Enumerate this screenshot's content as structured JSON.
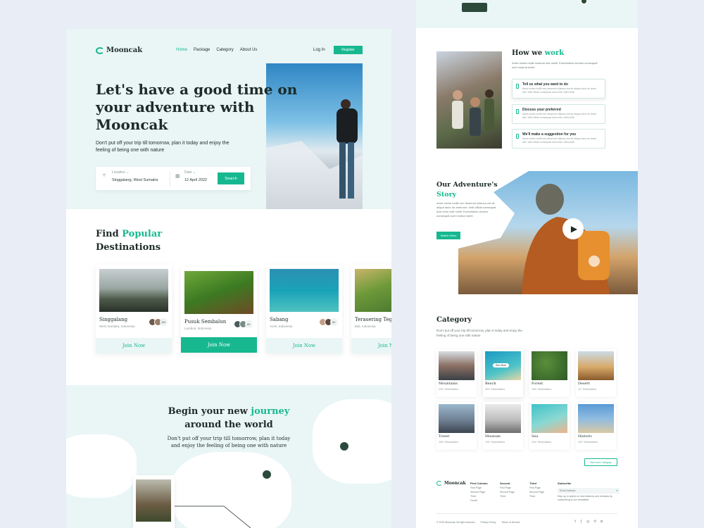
{
  "brand": {
    "name": "Mooncak",
    "accent": "#17b890"
  },
  "nav": {
    "items": [
      "Home",
      "Package",
      "Category",
      "About Us"
    ],
    "login": "Log In",
    "register": "Register"
  },
  "hero": {
    "title_line1": "Let's have a good time on",
    "title_line2": "your adventure with",
    "title_line3": "Mooncak",
    "subtitle": "Don't put off your trip till tomorrow, plan it today and enjoy the feeling of being one with nature"
  },
  "search": {
    "location_label": "Location",
    "location_value": "Singgalang, West Sumatra",
    "date_label": "Date",
    "date_value": "12 April 2022",
    "button": "Search"
  },
  "popular": {
    "title_a": "Find ",
    "title_b": "Popular",
    "title_c": "Destinations",
    "cards": [
      {
        "name": "Singgalang",
        "loc": "West Sumatra, Indonesia",
        "count": "12+",
        "join": "Join Now"
      },
      {
        "name": "Pusuk Sembalun",
        "loc": "Lombok, Indonesia",
        "count": "8+",
        "join": "Join Now"
      },
      {
        "name": "Sabang",
        "loc": "Aceh, Indonesia",
        "count": "6+",
        "join": "Join Now"
      },
      {
        "name": "Terasering Tegallalang",
        "loc": "Bali, Indonesia",
        "count": "",
        "join": "Join Now"
      }
    ]
  },
  "journey": {
    "title_a": "Begin your new ",
    "title_b": "journey",
    "title_c": "around the world",
    "subtitle": "Don't put off your trip till tomorrow, plan it today and enjoy the feeling of being one with nature"
  },
  "how": {
    "title_a": "How we ",
    "title_b": "work",
    "desc": "Amet minim mollit nostrum sint mollit. Exercitation veniam consequat sunt nostrud amet.",
    "steps": [
      {
        "t": "Tell us what you want to do",
        "d": "Amet minim mollit non deserunt ullamco est sit aliqua dolor do amet sint. Velit officia consequat duis enim velit mollit."
      },
      {
        "t": "Discuss your preferred",
        "d": "Amet minim mollit non deserunt ullamco est sit aliqua dolor do amet sint. Velit officia consequat duis enim velit mollit."
      },
      {
        "t": "We'll make a suggestion for you",
        "d": "Amet minim mollit non deserunt ullamco est sit aliqua dolor do amet sint. Velit officia consequat duis enim velit mollit."
      }
    ]
  },
  "story": {
    "title_a": "Our Adventure's",
    "title_b": "Story",
    "desc": "Amet minim mollit non deserunt ullamco est sit aliqua dolor do amet sint. Velit officia consequat duis enim velit mollit. Exercitation veniam consequat sunt nostrud amet.",
    "button": "Watch Video"
  },
  "category": {
    "title": "Category",
    "desc": "Don't put off your trip till tomorrow, plan it today and enjoy the feeling of being one with nature",
    "more": "See more Category",
    "see_more": "See More",
    "items": [
      {
        "n": "Mountains",
        "c": "223+ Destinations"
      },
      {
        "n": "Beach",
        "c": "302+ Destinations"
      },
      {
        "n": "Forest",
        "c": "106+ Destinations"
      },
      {
        "n": "Desert",
        "c": "12+ Destinations"
      },
      {
        "n": "Tower",
        "c": "263+ Destinations"
      },
      {
        "n": "Museum",
        "c": "120+ Destinations"
      },
      {
        "n": "Sea",
        "c": "104+ Destinations"
      },
      {
        "n": "Historic",
        "c": "422+ Destinations"
      }
    ]
  },
  "footer": {
    "cols": [
      {
        "h": "First Column",
        "l": [
          "First Page",
          "Second Page",
          "Third",
          "Fourth"
        ]
      },
      {
        "h": "Second",
        "l": [
          "First Page",
          "Second Page",
          "Third"
        ]
      },
      {
        "h": "Third",
        "l": [
          "First Page",
          "Second Page",
          "Third"
        ]
      }
    ],
    "subscribe": "Subscribe",
    "email_placeholder": "Email Address",
    "subscribe_note": "Stay up to speed on new features and releases by subscribing to our newsletter",
    "copyright": "© 2022 Mooncak. All right reserved",
    "privacy": "Privacy Policy",
    "terms": "Terms of Service"
  }
}
